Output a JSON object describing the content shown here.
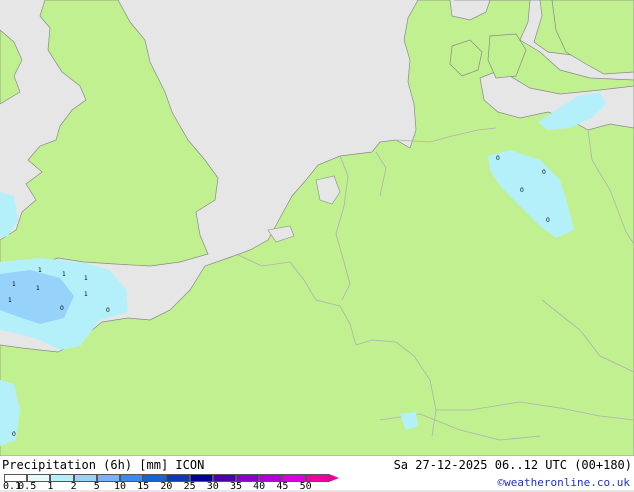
{
  "map": {
    "colors": {
      "sea": "#e6e6e6",
      "land": "#c0f090",
      "border": "#b0b0b0",
      "coast": "#8a8a8a",
      "light_precip": "#b4f0fa",
      "medium_precip": "#96d2fa"
    },
    "precip_cell_values": [
      "1",
      "1",
      "1",
      "1",
      "1",
      "1",
      "1",
      "0",
      "0",
      "0",
      "0",
      "0",
      "0",
      "0"
    ]
  },
  "footer": {
    "title": "Precipitation (6h) [mm] ICON",
    "datetime": "Sa 27-12-2025 06..12 UTC (00+180)",
    "credit": "©weatheronline.co.uk",
    "scale": [
      {
        "label": "0.1",
        "color": "#ffffff"
      },
      {
        "label": "0.5",
        "color": "#e6fafa"
      },
      {
        "label": "1",
        "color": "#b4f0fa"
      },
      {
        "label": "2",
        "color": "#96d2fa"
      },
      {
        "label": "5",
        "color": "#78b4fa"
      },
      {
        "label": "10",
        "color": "#3c8cf0"
      },
      {
        "label": "15",
        "color": "#1464d2"
      },
      {
        "label": "20",
        "color": "#0a3cb4"
      },
      {
        "label": "25",
        "color": "#000096"
      },
      {
        "label": "30",
        "color": "#5000aa"
      },
      {
        "label": "35",
        "color": "#8c00c8"
      },
      {
        "label": "40",
        "color": "#b400dc"
      },
      {
        "label": "45",
        "color": "#dc00dc"
      },
      {
        "label": "50",
        "color": "#f000a0"
      }
    ]
  }
}
